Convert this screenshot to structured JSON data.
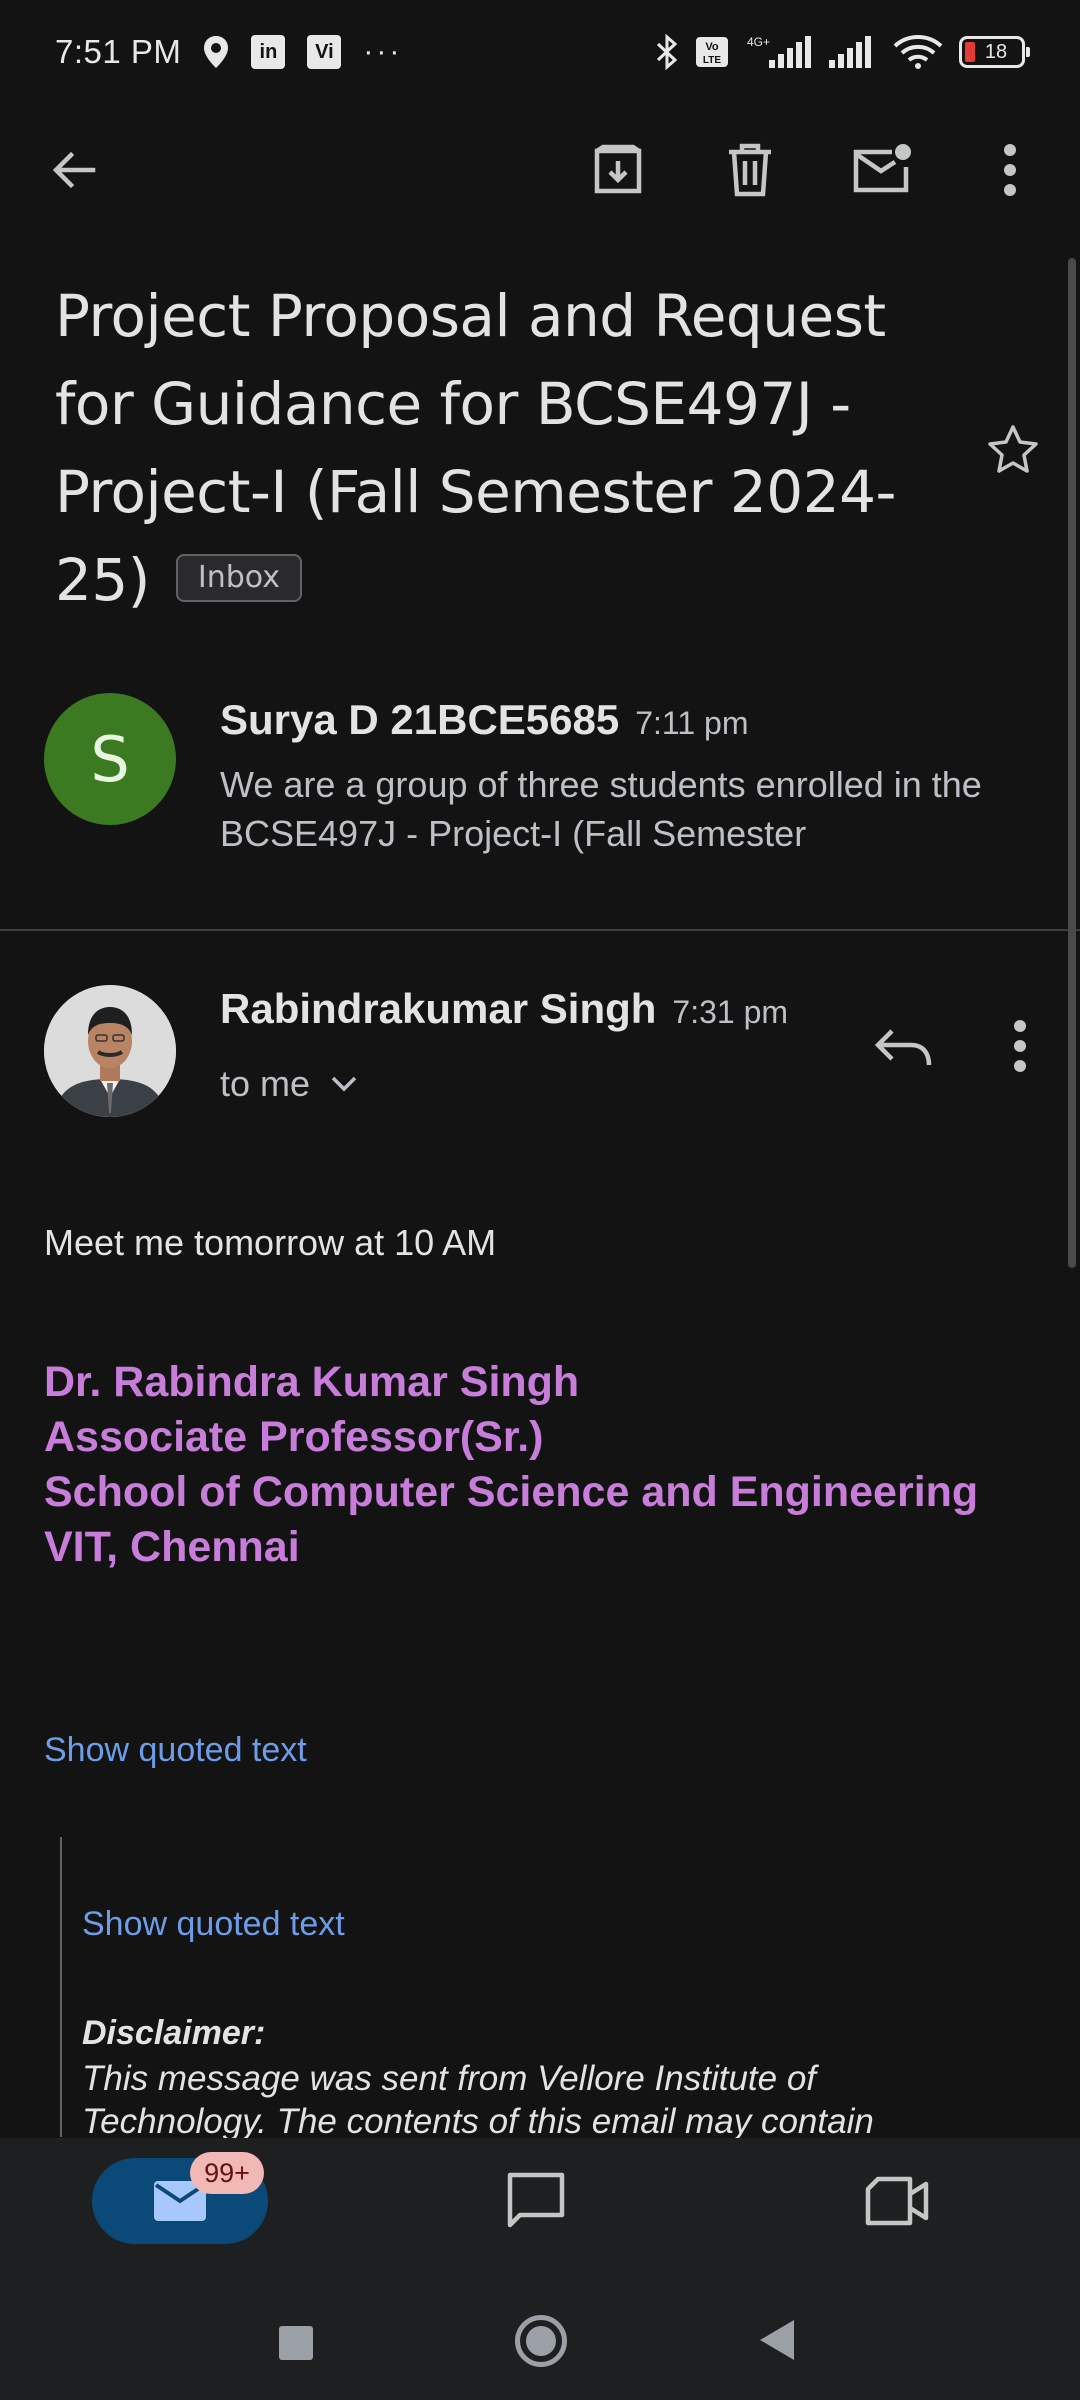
{
  "status_bar": {
    "time": "7:51 PM",
    "linkedin_label": "in",
    "vi_label": "Vi",
    "more_dots": "···",
    "battery_level": "18"
  },
  "email": {
    "subject": "Project Proposal and Request for Guidance for BCSE497J - Project-I (Fall Semester 2024-25)",
    "label": "Inbox"
  },
  "collapsed_message": {
    "avatar_letter": "S",
    "sender": "Surya D 21BCE5685",
    "time": "7:11 pm",
    "snippet": "We are a group of three students enrolled in the BCSE497J - Project-I (Fall Semester"
  },
  "open_message": {
    "sender": "Rabindrakumar Singh",
    "time": "7:31 pm",
    "recipient": "to me",
    "body": "Meet me tomorrow at 10 AM",
    "signature": {
      "line1": "Dr. Rabindra Kumar Singh",
      "line2": "Associate Professor(Sr.)",
      "line3": "School of Computer Science and Engineering",
      "line4": "VIT, Chennai"
    },
    "show_quoted_1": "Show quoted text",
    "show_quoted_2": "Show quoted text",
    "disclaimer_title": "Disclaimer:",
    "disclaimer_text": "This message was sent from Vellore Institute of Technology.  The contents of this email may contain"
  },
  "bottom_nav": {
    "mail_badge": "99+"
  },
  "colors": {
    "background": "#131314",
    "signature": "#c77dd9",
    "link": "#6e9de8",
    "avatar_green": "#3c7a22",
    "nav_active": "#0b4a78"
  }
}
